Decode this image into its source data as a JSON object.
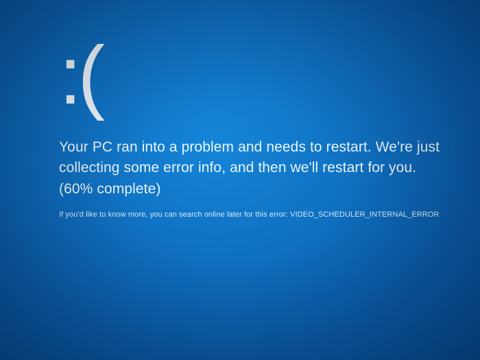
{
  "bsod": {
    "emoticon": ":(",
    "message": "Your PC ran into a problem and needs to restart. We're just collecting some error info, and then we'll restart for you. (60% complete)",
    "progress_percent": 60,
    "hint_prefix": "If you'd like to know more, you can search online later for this error: ",
    "error_code": "VIDEO_SCHEDULER_INTERNAL_ERROR"
  }
}
